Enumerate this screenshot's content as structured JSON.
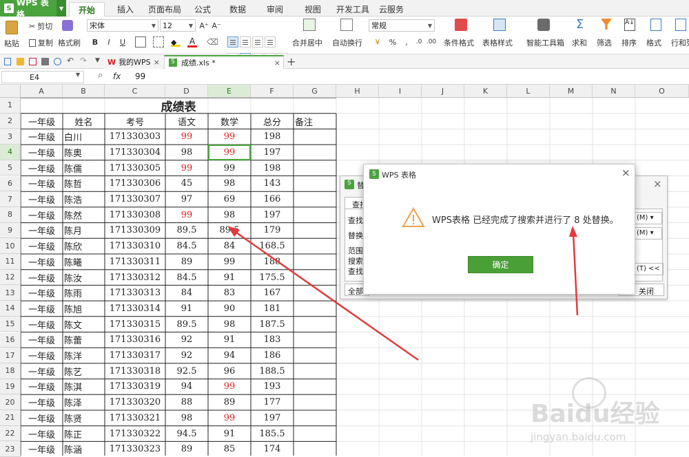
{
  "app": {
    "name": "WPS 表格"
  },
  "ribbon_tabs": [
    "开始",
    "插入",
    "页面布局",
    "公式",
    "数据",
    "审阅",
    "视图",
    "开发工具",
    "云服务"
  ],
  "ribbon": {
    "paste": "粘贴",
    "cut": "剪切",
    "copy": "复制",
    "format_painter": "格式刷",
    "font_name": "宋体",
    "font_size": "12",
    "bold": "B",
    "italic": "I",
    "underline": "U",
    "inc_font": "A⁺",
    "dec_font": "A⁻",
    "merge_center": "合并居中",
    "wrap_text": "自动换行",
    "number_format": "常规",
    "percent": "%",
    "thousands": ",",
    "cond_format": "条件格式",
    "table_style": "表格样式",
    "smart_toolbox": "智能工具箱",
    "sum": "求和",
    "filter": "筛选",
    "sort": "排序",
    "format": "格式",
    "rows_cols": "行和列"
  },
  "doc_tabs": [
    {
      "label": "我的WPS"
    },
    {
      "label": "成绩.xls *"
    }
  ],
  "formula_bar": {
    "name_box": "E4",
    "fx": "fx",
    "value": "99"
  },
  "columns": [
    "A",
    "B",
    "C",
    "D",
    "E",
    "F",
    "G",
    "H",
    "I",
    "J",
    "K",
    "L",
    "M",
    "N",
    "O"
  ],
  "rows": [
    "1",
    "2",
    "3",
    "4",
    "5",
    "6",
    "7",
    "8",
    "9",
    "10",
    "11",
    "12",
    "13",
    "14",
    "15",
    "16",
    "17",
    "18",
    "19",
    "20",
    "21",
    "22",
    "23"
  ],
  "sheet": {
    "title": "成绩表",
    "headers": [
      "一年级",
      "姓名",
      "考号",
      "语文",
      "数学",
      "总分",
      "备注"
    ],
    "records": [
      [
        "一年级",
        "白川",
        "171330303",
        "99",
        "99",
        "198"
      ],
      [
        "一年级",
        "陈奥",
        "171330304",
        "98",
        "99",
        "197"
      ],
      [
        "一年级",
        "陈儒",
        "171330305",
        "99",
        "99",
        "198"
      ],
      [
        "一年级",
        "陈哲",
        "171330306",
        "45",
        "98",
        "143"
      ],
      [
        "一年级",
        "陈浩",
        "171330307",
        "97",
        "69",
        "166"
      ],
      [
        "一年级",
        "陈然",
        "171330308",
        "99",
        "98",
        "197"
      ],
      [
        "一年级",
        "陈月",
        "171330309",
        "89.5",
        "89.5",
        "179"
      ],
      [
        "一年级",
        "陈欣",
        "171330310",
        "84.5",
        "84",
        "168.5"
      ],
      [
        "一年级",
        "陈曦",
        "171330311",
        "89",
        "99",
        "188"
      ],
      [
        "一年级",
        "陈汝",
        "171330312",
        "84.5",
        "91",
        "175.5"
      ],
      [
        "一年级",
        "陈雨",
        "171330313",
        "84",
        "83",
        "167"
      ],
      [
        "一年级",
        "陈旭",
        "171330314",
        "91",
        "90",
        "181"
      ],
      [
        "一年级",
        "陈文",
        "171330315",
        "89.5",
        "98",
        "187.5"
      ],
      [
        "一年级",
        "陈蕾",
        "171330316",
        "92",
        "91",
        "183"
      ],
      [
        "一年级",
        "陈洋",
        "171330317",
        "92",
        "94",
        "186"
      ],
      [
        "一年级",
        "陈艺",
        "171330318",
        "92.5",
        "96",
        "188.5"
      ],
      [
        "一年级",
        "陈淇",
        "171330319",
        "94",
        "99",
        "193"
      ],
      [
        "一年级",
        "陈泽",
        "171330320",
        "88",
        "89",
        "177"
      ],
      [
        "一年级",
        "陈贤",
        "171330321",
        "98",
        "99",
        "197"
      ],
      [
        "一年级",
        "陈正",
        "171330322",
        "94.5",
        "91",
        "185.5"
      ],
      [
        "一年级",
        "陈涵",
        "171330323",
        "89",
        "85",
        "174"
      ]
    ],
    "red_scores": [
      [
        0,
        3
      ],
      [
        0,
        4
      ],
      [
        1,
        4
      ],
      [
        2,
        3
      ],
      [
        5,
        3
      ],
      [
        16,
        4
      ],
      [
        18,
        4
      ]
    ],
    "selected_cell": "E4"
  },
  "find_dialog": {
    "title_partial": "替",
    "tab_partial": "查找",
    "find_label": "查找",
    "replace_label": "替换",
    "scope_label": "范围",
    "search_label": "搜索",
    "lookin_label": "查找",
    "combo_suffix": "(M)",
    "options_btn": "(T) <<",
    "replace_all_partial": "全部",
    "close_partial": "关闭"
  },
  "alert_dialog": {
    "title": "WPS 表格",
    "message": "WPS表格 已经完成了搜索并进行了 8 处替换。",
    "ok": "确定"
  },
  "watermark": {
    "brand": "Baidu经验",
    "url": "jingyan.baidu.com"
  },
  "colors": {
    "accent": "#4aa33d",
    "arrow": "#e53a3a",
    "red_text": "#e02020",
    "warning": "#f0a04a"
  }
}
